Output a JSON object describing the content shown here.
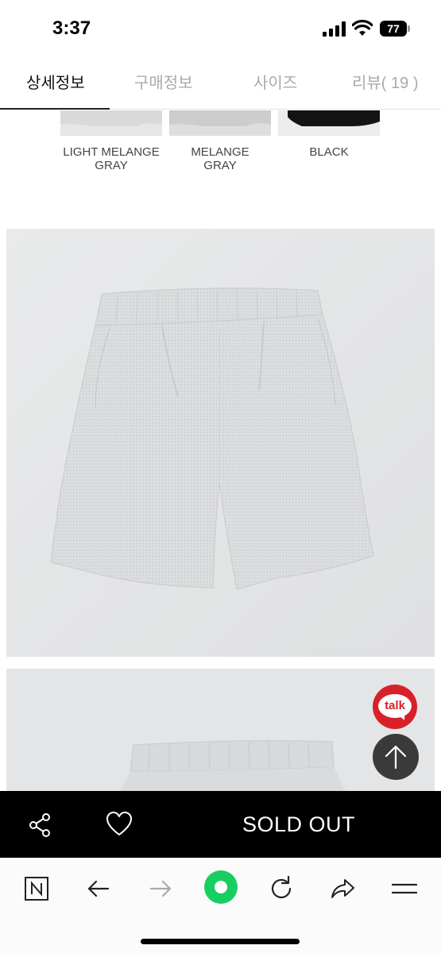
{
  "status_bar": {
    "time": "3:37",
    "battery": "77"
  },
  "tabs": [
    {
      "label": "상세정보",
      "active": true
    },
    {
      "label": "구매정보",
      "active": false
    },
    {
      "label": "사이즈",
      "active": false
    },
    {
      "label": "리뷰( 19 )",
      "active": false
    }
  ],
  "swatches": [
    {
      "line1": "LIGHT MELANGE",
      "line2": "GRAY"
    },
    {
      "line1": "MELANGE",
      "line2": "GRAY"
    },
    {
      "line1": "BLACK",
      "line2": ""
    }
  ],
  "floating": {
    "talk_label": "talk"
  },
  "action_bar": {
    "sold_out_label": "SOLD OUT"
  },
  "colors": {
    "talk_red": "#d8202a",
    "naver_green": "#19ce60",
    "action_bar_bg": "#000000",
    "image_bg": "#e6e7e8"
  },
  "icons": {
    "share": "share-icon",
    "like": "heart-icon",
    "naver": "naver-n-icon",
    "back": "arrow-left-icon",
    "forward": "arrow-right-icon",
    "home": "green-circle-icon",
    "refresh": "refresh-icon",
    "send": "share-arrow-icon",
    "menu": "hamburger-menu-icon",
    "top": "arrow-up-icon"
  }
}
